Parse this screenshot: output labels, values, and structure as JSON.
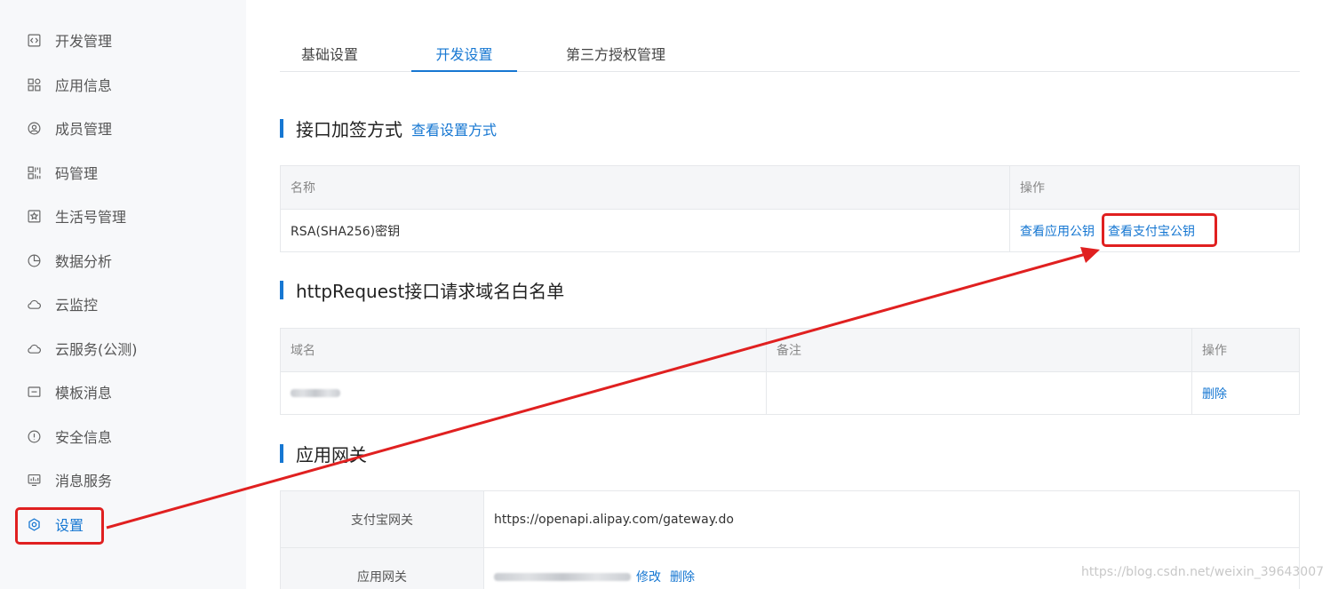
{
  "sidebar": {
    "items": [
      {
        "label": "开发管理",
        "icon": "code-icon"
      },
      {
        "label": "应用信息",
        "icon": "grid-icon"
      },
      {
        "label": "成员管理",
        "icon": "user-circle-icon"
      },
      {
        "label": "码管理",
        "icon": "qrcode-icon"
      },
      {
        "label": "生活号管理",
        "icon": "life-account-icon"
      },
      {
        "label": "数据分析",
        "icon": "pie-chart-icon"
      },
      {
        "label": "云监控",
        "icon": "cloud-icon"
      },
      {
        "label": "云服务(公测)",
        "icon": "cloud-icon"
      },
      {
        "label": "模板消息",
        "icon": "message-icon"
      },
      {
        "label": "安全信息",
        "icon": "shield-icon"
      },
      {
        "label": "消息服务",
        "icon": "monitor-icon"
      },
      {
        "label": "设置",
        "icon": "gear-icon",
        "active": true
      }
    ]
  },
  "tabs": [
    "基础设置",
    "开发设置",
    "第三方授权管理"
  ],
  "active_tab": "开发设置",
  "sign_section": {
    "title": "接口加签方式",
    "link": "查看设置方式",
    "headers": {
      "name": "名称",
      "action": "操作"
    },
    "row": {
      "name": "RSA(SHA256)密钥",
      "view_app_key": "查看应用公钥",
      "view_alipay_key": "查看支付宝公钥"
    }
  },
  "whitelist_section": {
    "title": "httpRequest接口请求域名白名单",
    "headers": {
      "domain": "域名",
      "remark": "备注",
      "action": "操作"
    },
    "row": {
      "delete": "删除"
    }
  },
  "gateway_section": {
    "title": "应用网关",
    "rows": {
      "alipay_label": "支付宝网关",
      "alipay_value": "https://openapi.alipay.com/gateway.do",
      "app_label": "应用网关",
      "app_edit": "修改",
      "app_delete": "删除"
    }
  },
  "colors": {
    "accent": "#1677d2",
    "annotation": "#e02020"
  },
  "watermark": "https://blog.csdn.net/weixin_39643007"
}
